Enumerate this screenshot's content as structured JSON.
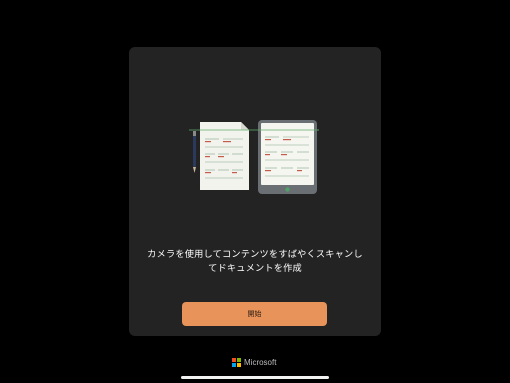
{
  "onboarding": {
    "message_line1": "カメラを使用してコンテンツをすばやくスキャンし",
    "message_line2": "てドキュメントを作成",
    "start_button_label": "開始"
  },
  "branding": {
    "name": "Microsoft",
    "logo_colors": [
      "#f25022",
      "#7fba00",
      "#00a4ef",
      "#ffb900"
    ]
  },
  "colors": {
    "background": "#000000",
    "card": "#232323",
    "accent": "#e8935a"
  },
  "icons": [
    "pen-icon",
    "paper-document-icon",
    "tablet-document-icon"
  ]
}
